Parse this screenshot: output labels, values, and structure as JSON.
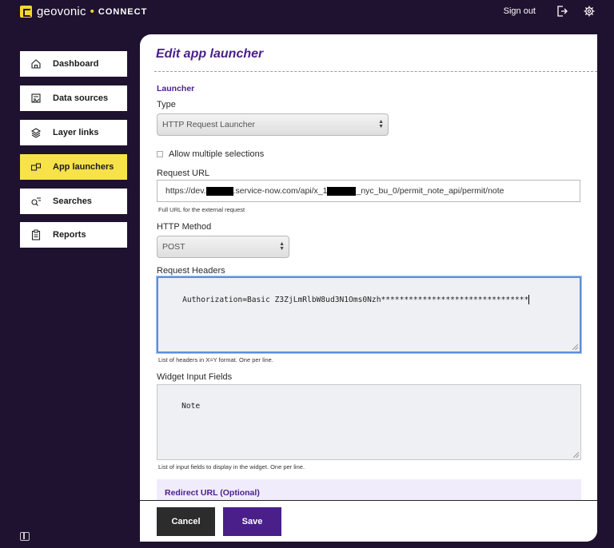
{
  "app": {
    "logo_name": "geovonic",
    "logo_dot": "•",
    "logo_sub": "CONNECT",
    "sign_out": "Sign out"
  },
  "sidebar": {
    "items": [
      {
        "label": "Dashboard",
        "icon": "home-icon",
        "active": false
      },
      {
        "label": "Data sources",
        "icon": "data-sources-icon",
        "active": false
      },
      {
        "label": "Layer links",
        "icon": "layers-icon",
        "active": false
      },
      {
        "label": "App launchers",
        "icon": "app-launcher-icon",
        "active": true
      },
      {
        "label": "Searches",
        "icon": "search-icon",
        "active": false
      },
      {
        "label": "Reports",
        "icon": "clipboard-icon",
        "active": false
      }
    ]
  },
  "form": {
    "title": "Edit app launcher",
    "section_launcher": "Launcher",
    "type_label": "Type",
    "type_value": "HTTP Request Launcher",
    "allow_multiple_label": "Allow multiple selections",
    "allow_multiple_checked": false,
    "request_url_label": "Request URL",
    "request_url_parts": {
      "p1": "https://dev.",
      "p2": ".service-now.com/api/x_1",
      "p3": "_nyc_bu_0/permit_note_api/permit/note"
    },
    "request_url_help": "Full URL for the external request",
    "http_method_label": "HTTP Method",
    "http_method_value": "POST",
    "headers_label": "Request Headers",
    "headers_value": "Authorization=Basic Z3ZjLmRlbW8ud3N1Oms0Nzh********************************",
    "headers_help": "List of headers in X=Y format. One per line.",
    "widget_fields_label": "Widget Input Fields",
    "widget_fields_value": "Note",
    "widget_fields_help": "List of input fields to display in the widget. One per line.",
    "redirect_label": "Redirect URL (Optional)"
  },
  "footer": {
    "cancel_label": "Cancel",
    "save_label": "Save"
  },
  "colors": {
    "background": "#1f1230",
    "accent": "#4a1f8a",
    "active_nav": "#f7e24a",
    "logo": "#f7d82f"
  }
}
